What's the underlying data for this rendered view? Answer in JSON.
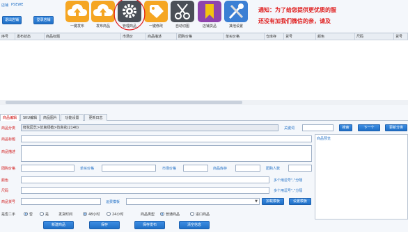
{
  "header": {
    "shop_label": "店铺",
    "shop_value": "PSEWE"
  },
  "left_buttons": {
    "exit_shop": "退出店铺",
    "login_shop": "登录店铺"
  },
  "toolbar": [
    {
      "id": "publish-one",
      "label": "一键发布",
      "icon": "upload-cloud-icon",
      "color": "#f5a623"
    },
    {
      "id": "publish-goods",
      "label": "发布商品",
      "icon": "upload-cloud-icon",
      "color": "#f5a623"
    },
    {
      "id": "manage-goods",
      "label": "管理商品",
      "icon": "gear-icon",
      "color": "#4a4f57"
    },
    {
      "id": "one-click-modify",
      "label": "一键修改",
      "icon": "tag-icon",
      "color": "#f5a623"
    },
    {
      "id": "auto-cut",
      "label": "自动切图",
      "icon": "scissors-icon",
      "color": "#4a4f57"
    },
    {
      "id": "shop-goods",
      "label": "店铺货品",
      "icon": "bookmark-icon",
      "color": "#8e44ad"
    },
    {
      "id": "other-settings",
      "label": "其他设置",
      "icon": "tools-icon",
      "color": "#3b7fd4"
    }
  ],
  "notice": {
    "line1": "通知：为了给您提供更优质的服",
    "line2": "还没有加我们微信的亲，请及"
  },
  "table": {
    "columns": [
      "序号",
      "发布状态",
      "商品标题",
      "市场价",
      "商品描述",
      "团购价格",
      "单买价格",
      "仓库存",
      "货号",
      "颜色",
      "尺码",
      "货号"
    ]
  },
  "tabs": [
    "商品编辑",
    "SKU编辑",
    "商品图片",
    "功能设置",
    "更新日志"
  ],
  "form": {
    "category_label": "商品分类",
    "category_value": "鲜花园艺>仿真绿植>仿真花(2140)",
    "shortcut_label": "关键词",
    "btn_search": "搜索",
    "btn_next": "下一个",
    "btn_update_category": "更新分类",
    "title_label": "商品标题",
    "desc_label": "商品描述",
    "group_price_label": "团购价格",
    "single_price_label": "单买价格",
    "market_price_label": "市场价格",
    "stock_label": "商品库存",
    "group_count_label": "团购人数",
    "color_label": "颜色",
    "size_label": "尺码",
    "color_hint": "多个用逗号\",\"分隔",
    "size_hint": "多个用逗号\",\"分隔",
    "sku_label": "商品货号",
    "template_label": "运费模板",
    "btn_add_template": "加载模板",
    "btn_set_template": "设置模板",
    "preview_label": "商品预览",
    "second_hand_label": "是否二手",
    "opt_yes": "否",
    "opt_no": "是",
    "ship_time_label": "发货时间",
    "opt_48h": "48小时",
    "opt_24h": "24小时",
    "goods_type_label": "商品类型",
    "opt_new": "普通商品",
    "opt_import": "进口商品"
  },
  "bottom_buttons": [
    "新建商品",
    "保存",
    "保存发布",
    "清空信息"
  ]
}
